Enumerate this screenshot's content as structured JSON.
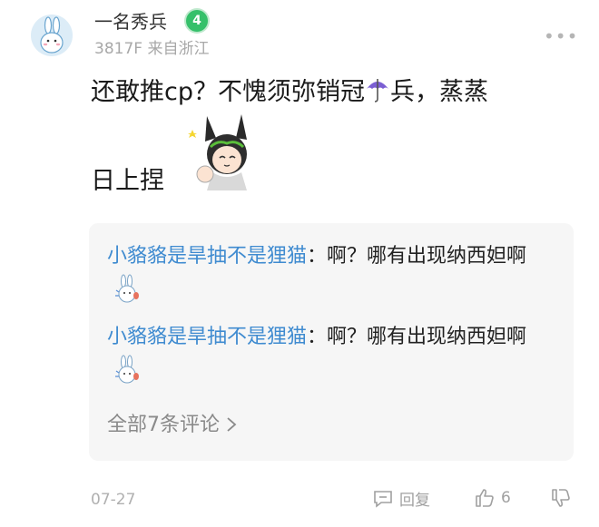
{
  "post": {
    "username": "一名秀兵",
    "level": "4",
    "floor_location": "3817F 来自浙江",
    "text_part1": "还敢推cp？不愧须弥销冠",
    "text_part2": "兵，蒸蒸",
    "text_line2": "日上捏",
    "date": "07-27",
    "reply_label": "回复",
    "like_count": "6"
  },
  "replies": [
    {
      "name": "小貉貉是旱抽不是狸猫",
      "text": "：啊？哪有出现纳西妲啊"
    },
    {
      "name": "小貉貉是旱抽不是狸猫",
      "text": "：啊？哪有出现纳西妲啊"
    }
  ],
  "all_comments_label": "全部7条评论",
  "colors": {
    "link": "#3f8bd0",
    "badge": "#35c06a",
    "meta": "#a8a8a8"
  }
}
